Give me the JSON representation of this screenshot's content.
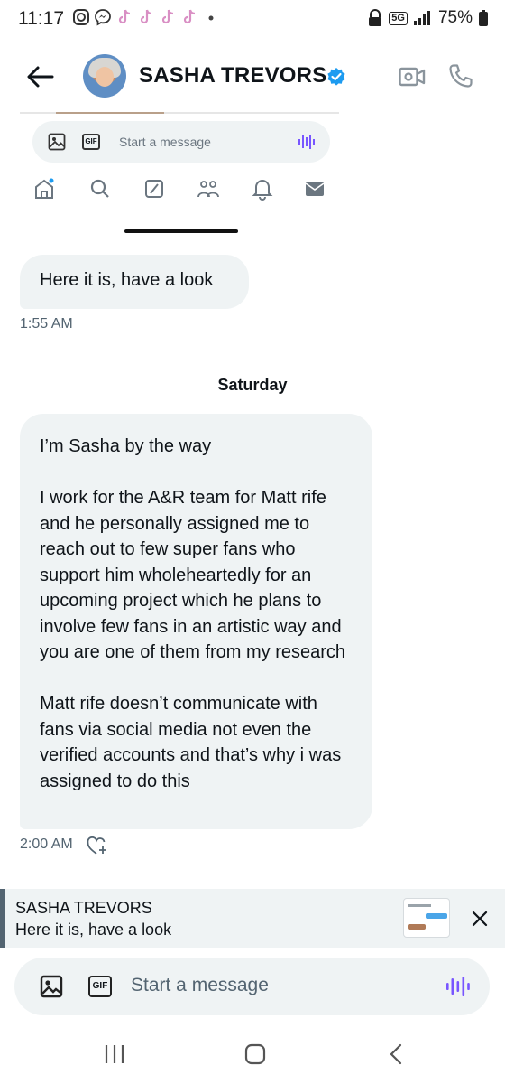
{
  "status_bar": {
    "time": "11:17",
    "network": "5G",
    "battery": "75%",
    "icons": [
      "instagram-icon",
      "messenger-icon",
      "tiktok-icon",
      "tiktok-icon",
      "tiktok-icon",
      "tiktok-icon",
      "dot-icon"
    ]
  },
  "header": {
    "contact_name": "SASHA TREVORS",
    "verified": true,
    "accent_color": "#1d9bf0"
  },
  "embedded_screenshot": {
    "placeholder": "Start a message",
    "gif_label": "GIF",
    "nav_icons": [
      "home-icon",
      "search-icon",
      "grok-icon",
      "communities-icon",
      "notifications-icon",
      "messages-icon"
    ]
  },
  "messages": [
    {
      "text": "Here it is, have a look",
      "time": "1:55 AM"
    },
    {
      "day_separator": "Saturday",
      "paragraphs": [
        "I’m Sasha by the way",
        "I work for the A&R team for Matt rife and he personally assigned me to reach out to few super fans who support him wholeheartedly for an upcoming project which he plans to involve few fans in an artistic way and you are one of them from my research",
        "Matt rife doesn’t communicate with fans via social media not even the verified accounts and that’s why i was assigned to do this"
      ],
      "time": "2:00 AM"
    }
  ],
  "reply_preview": {
    "name": "SASHA TREVORS",
    "text": "Here it is, have a look"
  },
  "composer": {
    "placeholder": "Start a message",
    "gif_label": "GIF",
    "voice_color": "#7856ff"
  }
}
